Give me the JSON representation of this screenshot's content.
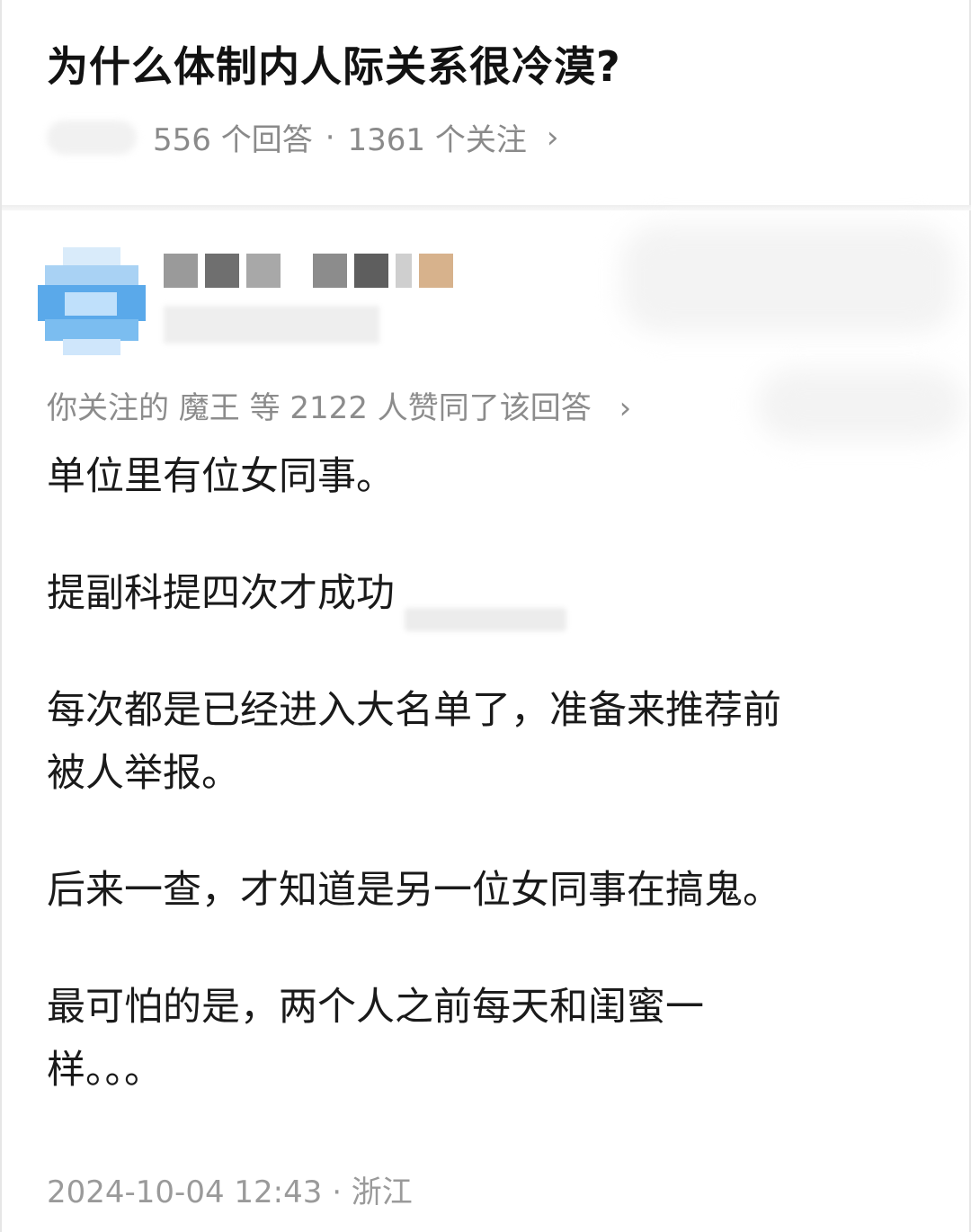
{
  "question": {
    "title": "为什么体制内人际关系很冷漠?",
    "meta": {
      "answers": "556 个回答",
      "separator": "·",
      "followers": "1361 个关注",
      "chevron": "›"
    }
  },
  "answer": {
    "upvote_line": "你关注的 魔王 等 2122 人赞同了该回答",
    "upvote_chevron": "›",
    "paragraphs": [
      "单位里有位女同事。",
      "提副科提四次才成功",
      "每次都是已经进入大名单了，准备来推荐前",
      "被人举报。",
      "后来一查，才知道是另一位女同事在搞鬼。",
      "最可怕的是，两个人之前每天和闺蜜一",
      "样。。。"
    ],
    "footer": "2024-10-04 12:43 · 浙江"
  },
  "colors": {
    "title": "#121212",
    "meta": "#8a8a8a",
    "body": "#1a1a1a",
    "footer": "#9a9a9a",
    "avatar_blue": "#4da3e8"
  },
  "icons": {
    "avatar": "avatar-icon",
    "chevron": "chevron-right-icon"
  }
}
